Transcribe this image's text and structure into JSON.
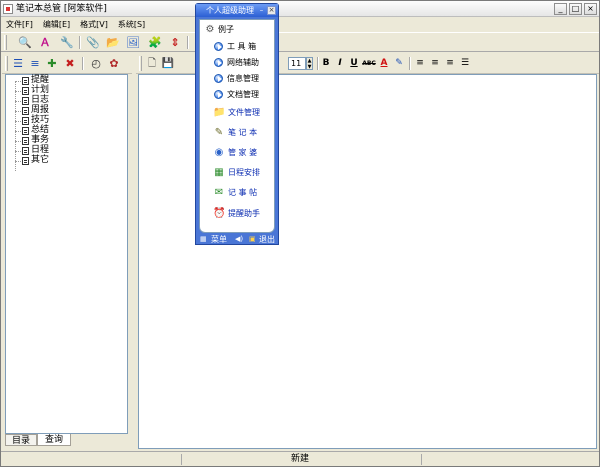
{
  "window": {
    "title": "笔记本总管 [阿笨软件]",
    "controls": [
      "_",
      "□",
      "×"
    ]
  },
  "menu": [
    {
      "label": "文件[F]"
    },
    {
      "label": "编辑[E]"
    },
    {
      "label": "格式[V]"
    },
    {
      "label": "系统[S]"
    }
  ],
  "toolbar_main": [
    {
      "icon": "preview-icon",
      "glyph": "🔍"
    },
    {
      "icon": "sort-icon",
      "glyph": "Ａ"
    },
    {
      "icon": "tools-icon",
      "glyph": "🔧"
    },
    {
      "icon": "attach-icon",
      "glyph": "📎"
    },
    {
      "icon": "import-icon",
      "glyph": "📂"
    },
    {
      "icon": "image-icon",
      "glyph": "🖼"
    },
    {
      "icon": "puzzle-icon",
      "glyph": "🧩"
    },
    {
      "icon": "split-icon",
      "glyph": "⇕"
    }
  ],
  "toolbar_left": [
    {
      "icon": "tree-expand-icon",
      "glyph": "☰"
    },
    {
      "icon": "tree-list-icon",
      "glyph": "≡"
    },
    {
      "icon": "add-node-icon",
      "glyph": "✚"
    },
    {
      "icon": "delete-node-icon",
      "glyph": "✖"
    },
    {
      "icon": "clock-icon",
      "glyph": "◴"
    },
    {
      "icon": "bug-icon",
      "glyph": "✿"
    }
  ],
  "tree": [
    {
      "label": "提醒"
    },
    {
      "label": "计划"
    },
    {
      "label": "日志"
    },
    {
      "label": "周报"
    },
    {
      "label": "技巧"
    },
    {
      "label": "总结"
    },
    {
      "label": "事务"
    },
    {
      "label": "日程"
    },
    {
      "label": "其它"
    }
  ],
  "left_tabs": [
    {
      "label": "目录",
      "active": false
    },
    {
      "label": "查询",
      "active": true
    }
  ],
  "editor_toolbar": {
    "font_size": "11",
    "format_buttons": [
      {
        "icon": "bold-icon",
        "glyph": "B"
      },
      {
        "icon": "italic-icon",
        "glyph": "I"
      },
      {
        "icon": "underline-icon",
        "glyph": "U"
      },
      {
        "icon": "strikethrough-icon",
        "glyph": "ABC"
      },
      {
        "icon": "font-color-icon",
        "glyph": "A"
      },
      {
        "icon": "highlight-icon",
        "glyph": "✎"
      },
      {
        "icon": "align-left-icon",
        "glyph": "≡"
      },
      {
        "icon": "align-center-icon",
        "glyph": "≡"
      },
      {
        "icon": "align-right-icon",
        "glyph": "≡"
      },
      {
        "icon": "bullet-list-icon",
        "glyph": "☰"
      }
    ]
  },
  "status": {
    "text": "新建"
  },
  "float_panel": {
    "title": "个人超级助理",
    "controls": [
      "–",
      "×"
    ],
    "root": {
      "label": "例子",
      "icon": "example-icon",
      "glyph": "⚙"
    },
    "sub_items": [
      {
        "label": "工 具 箱"
      },
      {
        "label": "网络辅助"
      },
      {
        "label": "信息管理"
      },
      {
        "label": "文档管理"
      }
    ],
    "items": [
      {
        "label": "文件管理",
        "icon": "file-manager-icon",
        "glyph": "📁"
      },
      {
        "label": "笔 记 本",
        "icon": "notebook-icon",
        "glyph": "✎"
      },
      {
        "label": "管 家 婆",
        "icon": "housekeeper-icon",
        "glyph": "◉"
      },
      {
        "label": "日程安排",
        "icon": "calendar-icon",
        "glyph": "▦"
      },
      {
        "label": "记 事 帖",
        "icon": "sticky-note-icon",
        "glyph": "✉"
      },
      {
        "label": "提醒助手",
        "icon": "reminder-icon",
        "glyph": "⏰"
      }
    ],
    "footer": {
      "menu_label": "菜单",
      "exit_label": "退出"
    }
  }
}
